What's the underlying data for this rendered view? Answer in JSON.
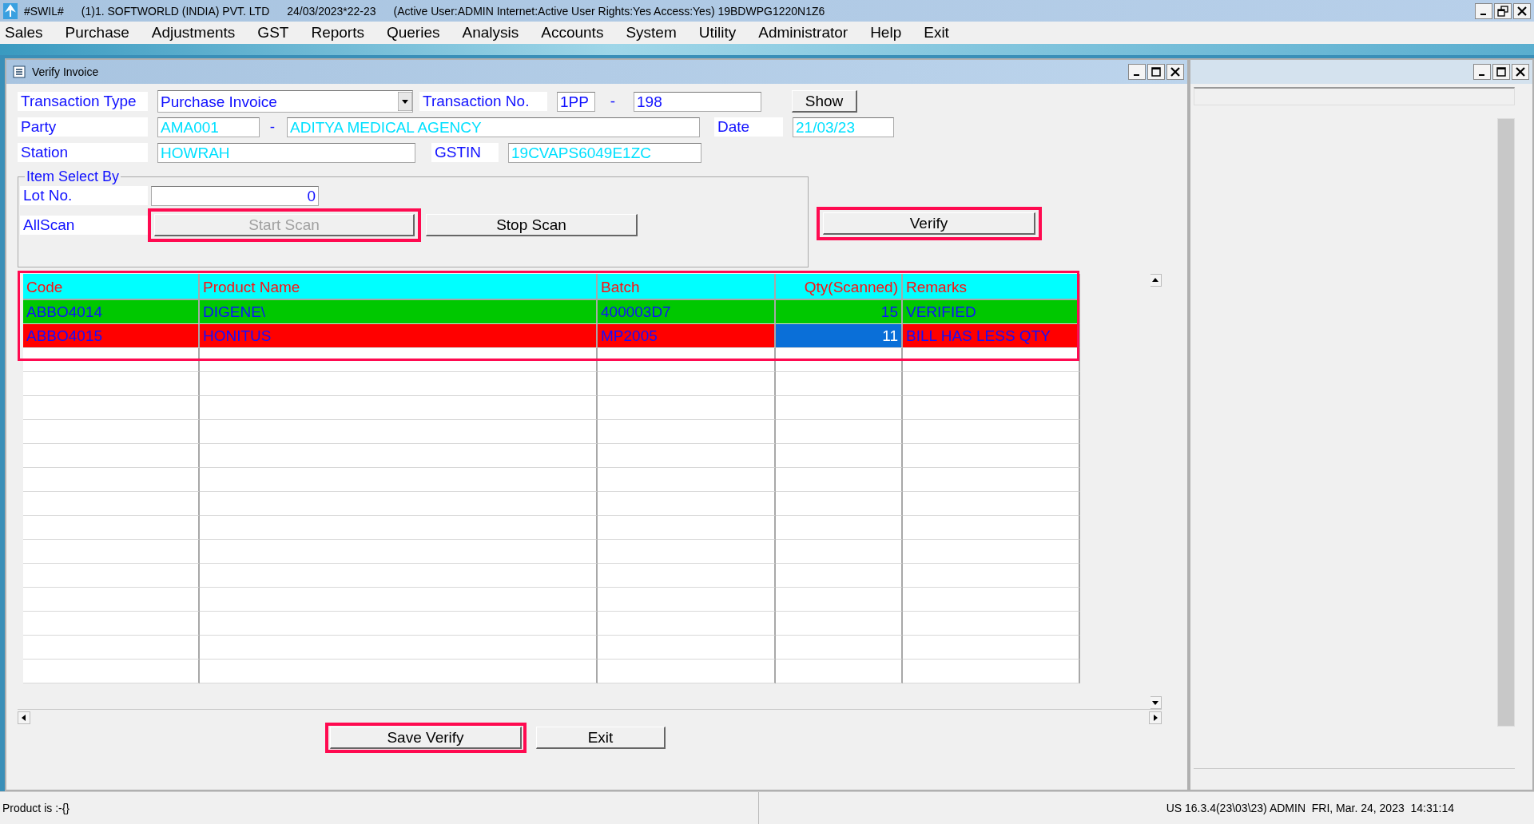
{
  "app_title_bar": {
    "app_name": "#SWIL#",
    "company": "(1)1. SOFTWORLD (INDIA) PVT. LTD",
    "period": "24/03/2023*22-23",
    "session": "(Active User:ADMIN Internet:Active  User Rights:Yes Access:Yes) 19BDWPG1220N1Z6"
  },
  "menu": [
    "Sales",
    "Purchase",
    "Adjustments",
    "GST",
    "Reports",
    "Queries",
    "Analysis",
    "Accounts",
    "System",
    "Utility",
    "Administrator",
    "Help",
    "Exit"
  ],
  "window": {
    "title": "Verify Invoice"
  },
  "form": {
    "transaction_type_label": "Transaction Type",
    "transaction_type": "Purchase Invoice",
    "transaction_no_label": "Transaction No.",
    "transaction_series": "1PP",
    "transaction_sep": "-",
    "transaction_no": "198",
    "show_button": "Show",
    "party_label": "Party",
    "party_code": "AMA001",
    "party_sep": "-",
    "party_name": "ADITYA MEDICAL AGENCY",
    "date_label": "Date",
    "date": "21/03/23",
    "station_label": "Station",
    "station": "HOWRAH",
    "gstin_label": "GSTIN",
    "gstin": "19CVAPS6049E1ZC"
  },
  "item_select": {
    "title": "Item Select By",
    "lot_label": "Lot No.",
    "lot_value": "0",
    "allscan_label": "AllScan"
  },
  "scan_buttons": [
    {
      "label": "Start Scan",
      "disabled": true,
      "highlighted": true
    },
    {
      "label": "Stop Scan",
      "disabled": false,
      "highlighted": false
    }
  ],
  "verify_button": {
    "label": "Verify",
    "highlighted": true
  },
  "table": {
    "highlighted": true,
    "columns": [
      "Code",
      "Product Name",
      "Batch",
      "Qty(Scanned)",
      "Remarks"
    ],
    "rows": [
      {
        "code": "ABBO4014",
        "product": "DIGENE\\",
        "batch": "400003D7",
        "qty": "15",
        "remarks": "VERIFIED",
        "color": "#00c800",
        "selected": false
      },
      {
        "code": "ABBO4015",
        "product": "HONITUS",
        "batch": "MP2005",
        "qty": "11",
        "remarks": "BILL HAS LESS QTY",
        "color": "#ff0000",
        "selected": true
      }
    ]
  },
  "footer_buttons": [
    {
      "label": "Save Verify",
      "highlighted": true
    },
    {
      "label": "Exit",
      "highlighted": false
    }
  ],
  "status_bar": {
    "message": "Product is :-{}",
    "info": "US 16.3.4(23\\03\\23) ADMIN  FRI, Mar. 24, 2023  14:31:14"
  }
}
